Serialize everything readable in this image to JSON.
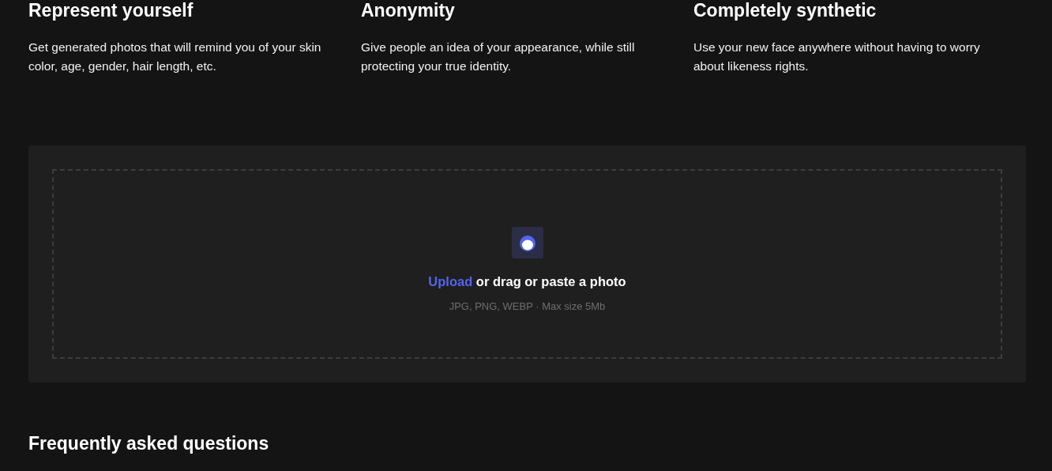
{
  "features": [
    {
      "title": "Represent yourself",
      "text": "Get generated photos that will remind you of your skin color, age, gender, hair length, etc."
    },
    {
      "title": "Anonymity",
      "text": "Give people an idea of your appearance, while still protecting your true identity."
    },
    {
      "title": "Completely synthetic",
      "text": "Use your new face anywhere without having to worry about likeness rights."
    }
  ],
  "upload": {
    "link": "Upload",
    "text": "or drag or paste a photo",
    "hint": "JPG, PNG, WEBP · Max size 5Mb"
  },
  "faq": {
    "title": "Frequently asked questions"
  }
}
